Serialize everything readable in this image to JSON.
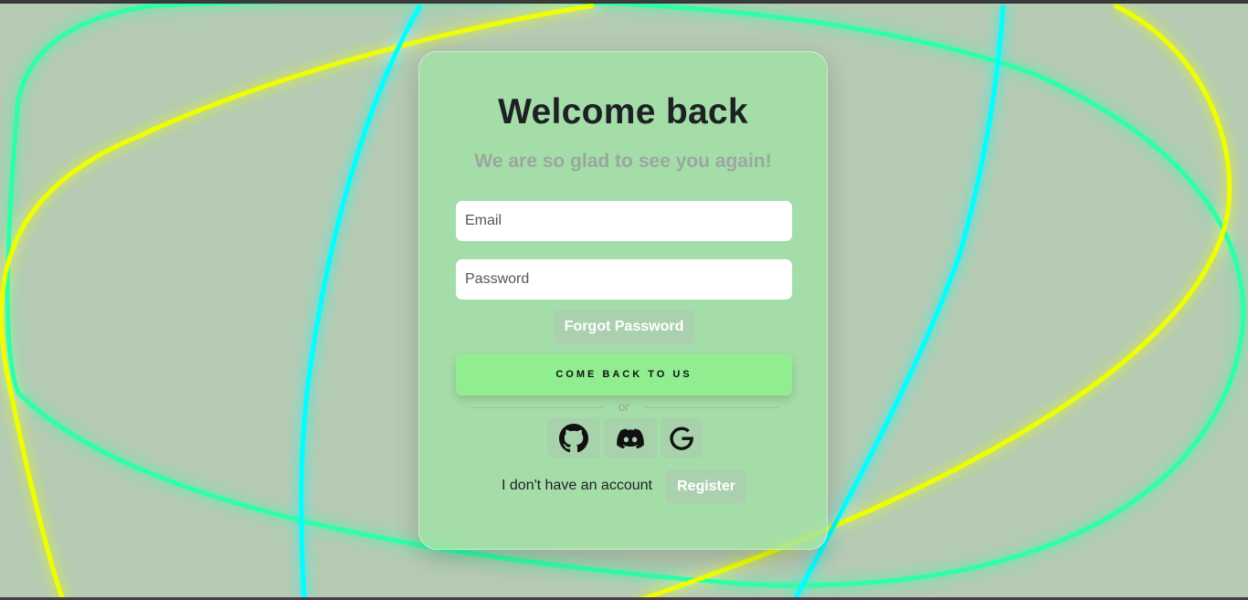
{
  "login": {
    "title": "Welcome back",
    "subtitle": "We are so glad to see you again!",
    "email_placeholder": "Email",
    "password_placeholder": "Password",
    "forgot_label": "Forgot Password",
    "submit_label": "COME BACK TO US",
    "divider_text": "or",
    "no_account_text": "I don't have an account",
    "register_label": "Register"
  },
  "social": [
    {
      "name": "github",
      "icon": "github-icon"
    },
    {
      "name": "discord",
      "icon": "discord-icon"
    },
    {
      "name": "google",
      "icon": "google-icon"
    }
  ],
  "colors": {
    "background": "#b5cbb3",
    "card": "#a0e1a5",
    "submit": "#90ee90",
    "ring_cyan": "#00ffff",
    "ring_green": "#2dffa6",
    "ring_yellow": "#eeff00",
    "title": "#1e2124",
    "subtitle": "#9aa7a0"
  }
}
